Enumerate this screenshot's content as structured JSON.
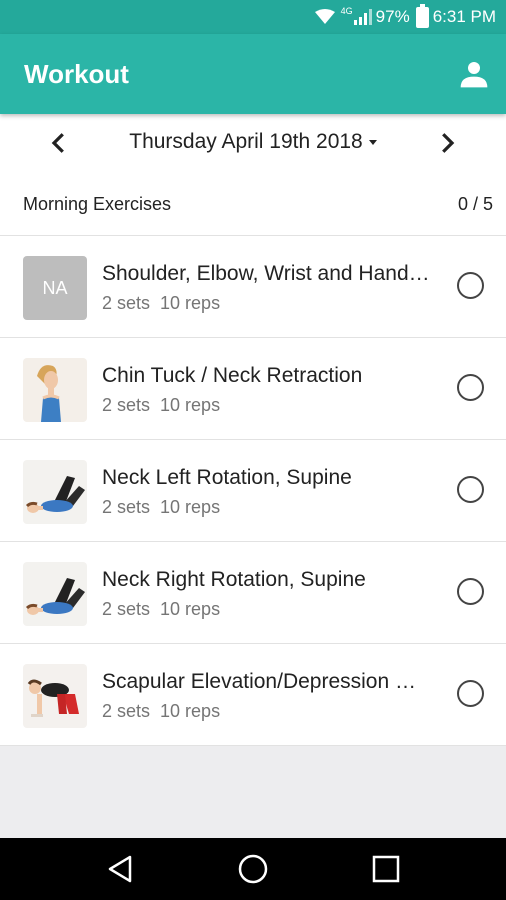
{
  "status_bar": {
    "network": "4G",
    "battery_percent": "97%",
    "time": "6:31 PM"
  },
  "app_bar": {
    "title": "Workout",
    "profile_icon": "person-icon"
  },
  "date_nav": {
    "date": "Thursday April 19th 2018",
    "prev_icon": "chevron-left-icon",
    "next_icon": "chevron-right-icon"
  },
  "section": {
    "title": "Morning Exercises",
    "count": "0 / 5"
  },
  "exercises": [
    {
      "name": "Shoulder, Elbow, Wrist and Hand…",
      "sets": "2 sets",
      "reps": "10 reps",
      "thumb_text": "NA",
      "thumb": "na-placeholder",
      "completed": false
    },
    {
      "name": "Chin Tuck / Neck Retraction",
      "sets": "2 sets",
      "reps": "10 reps",
      "thumb": "woman-profile-photo",
      "completed": false
    },
    {
      "name": "Neck Left Rotation, Supine",
      "sets": "2 sets",
      "reps": "10 reps",
      "thumb": "woman-lying-supine-photo",
      "completed": false
    },
    {
      "name": "Neck Right Rotation, Supine",
      "sets": "2 sets",
      "reps": "10 reps",
      "thumb": "woman-lying-supine-photo",
      "completed": false
    },
    {
      "name": "Scapular Elevation/Depression …",
      "sets": "2 sets",
      "reps": "10 reps",
      "thumb": "woman-quadruped-photo",
      "completed": false
    }
  ],
  "colors": {
    "app_bar": "#2bb5a7",
    "status_bar": "#24a99b",
    "background": "#ededef"
  }
}
